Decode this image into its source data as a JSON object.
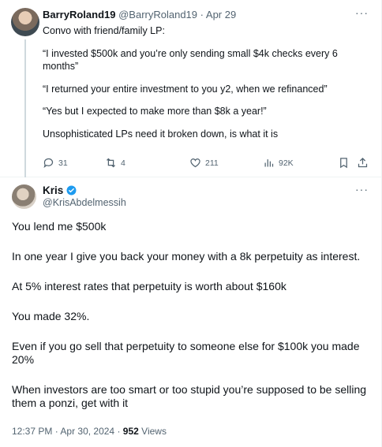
{
  "parent_tweet": {
    "display_name": "BarryRoland19",
    "handle": "@BarryRoland19",
    "separator": "·",
    "date": "Apr 29",
    "paragraphs": [
      "Convo with friend/family LP:",
      "“I invested $500k and you’re only sending small $4k checks every 6 months”",
      "“I returned your entire investment to you y2, when we refinanced”",
      "“Yes but I expected to make more than $8k a year!”",
      "Unsophisticated LPs need it broken down, is what it is"
    ],
    "stats": {
      "replies": "31",
      "reposts": "4",
      "likes": "211",
      "views": "92K"
    }
  },
  "main_tweet": {
    "display_name": "Kris",
    "handle": "@KrisAbdelmessih",
    "paragraphs": [
      "You lend me $500k",
      "In one year I give you back your money with a 8k perpetuity as interest.",
      "At 5% interest rates that perpetuity is worth about $160k",
      "You made 32%.",
      "Even if you go sell that perpetuity to someone else for $100k you made 20%",
      "When investors are too smart or too stupid you’re supposed to be selling them a ponzi, get with it"
    ],
    "time": "12:37 PM",
    "separator": "·",
    "date": "Apr 30, 2024",
    "views": "952",
    "views_label": "Views"
  },
  "more_label": "···",
  "colors": {
    "text": "#0f1419",
    "secondary": "#536471",
    "verified_blue": "#1d9bf0",
    "divider": "#eff3f4"
  },
  "icons": [
    "reply-icon",
    "repost-icon",
    "like-icon",
    "views-icon",
    "bookmark-icon",
    "share-icon",
    "more-icon",
    "verified-icon"
  ]
}
